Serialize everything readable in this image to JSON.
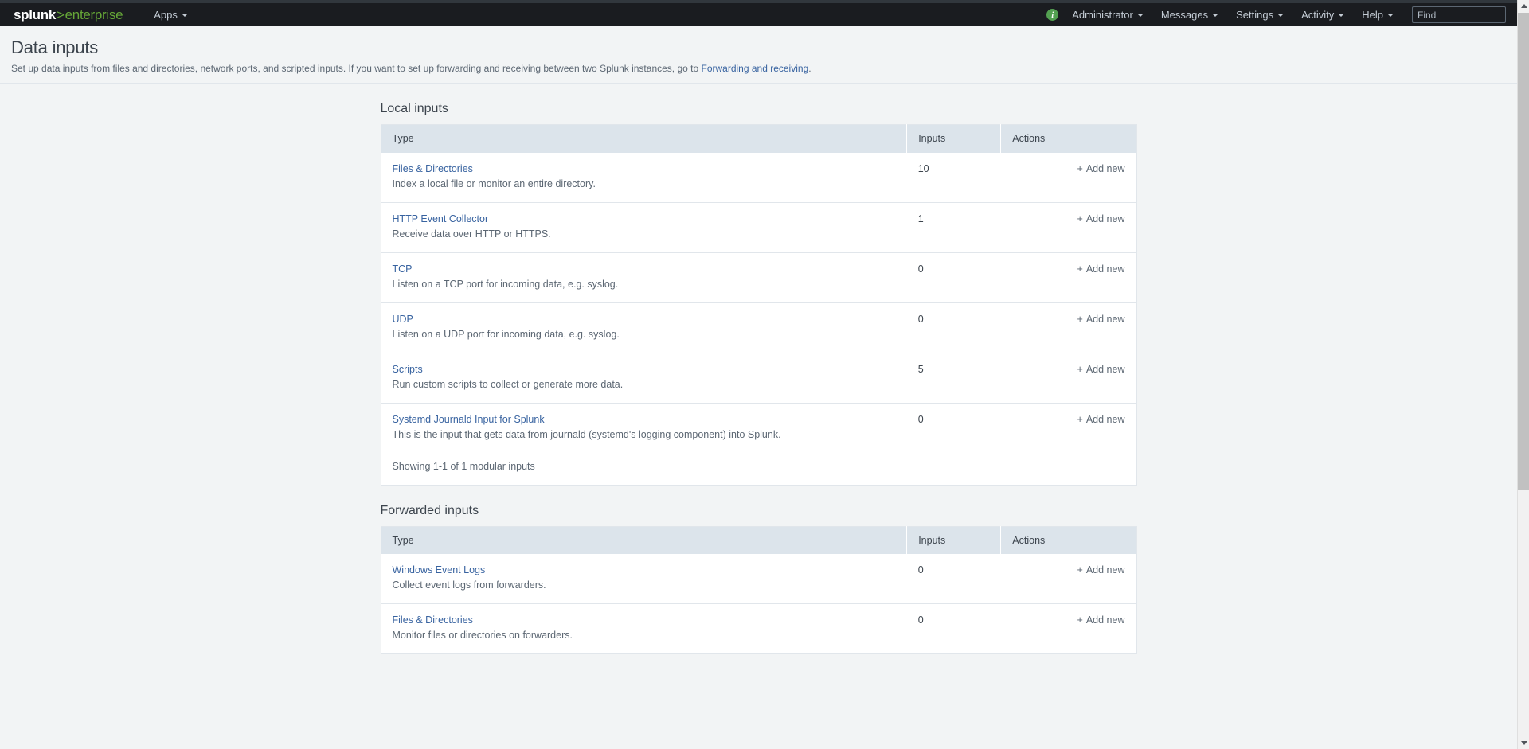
{
  "header": {
    "brand": {
      "splunk": "splunk",
      "gt": ">",
      "enterprise": "enterprise"
    },
    "apps_label": "Apps",
    "info_icon_label": "i",
    "nav_right": [
      {
        "label": "Administrator",
        "name": "nav-administrator"
      },
      {
        "label": "Messages",
        "name": "nav-messages"
      },
      {
        "label": "Settings",
        "name": "nav-settings"
      },
      {
        "label": "Activity",
        "name": "nav-activity"
      },
      {
        "label": "Help",
        "name": "nav-help"
      }
    ],
    "find": {
      "placeholder": "Find",
      "value": ""
    }
  },
  "page": {
    "title": "Data inputs",
    "description_before": "Set up data inputs from files and directories, network ports, and scripted inputs. If you want to set up forwarding and receiving between two Splunk instances, go to ",
    "description_link": "Forwarding and receiving",
    "description_after": "."
  },
  "columns": {
    "type": "Type",
    "inputs": "Inputs",
    "actions": "Actions"
  },
  "add_new_label": "Add new",
  "add_new_plus": "+",
  "sections": [
    {
      "title": "Local inputs",
      "name": "local-inputs",
      "rows": [
        {
          "type": "Files & Directories",
          "desc": "Index a local file or monitor an entire directory.",
          "inputs": "10"
        },
        {
          "type": "HTTP Event Collector",
          "desc": "Receive data over HTTP or HTTPS.",
          "inputs": "1"
        },
        {
          "type": "TCP",
          "desc": "Listen on a TCP port for incoming data, e.g. syslog.",
          "inputs": "0"
        },
        {
          "type": "UDP",
          "desc": "Listen on a UDP port for incoming data, e.g. syslog.",
          "inputs": "0"
        },
        {
          "type": "Scripts",
          "desc": "Run custom scripts to collect or generate more data.",
          "inputs": "5"
        },
        {
          "type": "Systemd Journald Input for Splunk",
          "desc": "This is the input that gets data from journald (systemd's logging component) into Splunk.",
          "inputs": "0",
          "note": "Showing 1-1 of 1 modular inputs"
        }
      ]
    },
    {
      "title": "Forwarded inputs",
      "name": "forwarded-inputs",
      "rows": [
        {
          "type": "Windows Event Logs",
          "desc": "Collect event logs from forwarders.",
          "inputs": "0"
        },
        {
          "type": "Files & Directories",
          "desc": "Monitor files or directories on forwarders.",
          "inputs": "0"
        }
      ]
    }
  ],
  "colors": {
    "brand_green": "#65a637",
    "header_dark": "#1a1c20",
    "link_blue": "#3863a0",
    "table_header": "#dce4eb",
    "page_bg": "#f2f4f5"
  }
}
